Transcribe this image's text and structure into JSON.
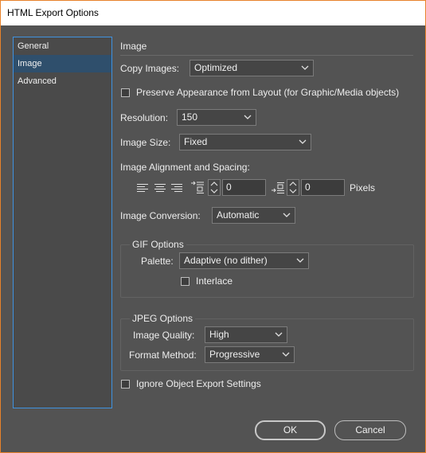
{
  "window": {
    "title": "HTML Export Options",
    "border_color": "#e8822a"
  },
  "sidebar": {
    "items": [
      {
        "label": "General",
        "active": false
      },
      {
        "label": "Image",
        "active": true
      },
      {
        "label": "Advanced",
        "active": false
      }
    ]
  },
  "section": {
    "title": "Image"
  },
  "copy_images": {
    "label": "Copy Images:",
    "value": "Optimized"
  },
  "preserve_appearance": {
    "label": "Preserve Appearance from Layout (for Graphic/Media objects)",
    "checked": false
  },
  "resolution": {
    "label": "Resolution:",
    "value": "150"
  },
  "image_size": {
    "label": "Image Size:",
    "value": "Fixed"
  },
  "alignment": {
    "label": "Image Alignment and Spacing:",
    "icons": [
      "align-left-icon",
      "align-center-icon",
      "align-right-icon",
      "space-before-icon",
      "space-after-icon"
    ],
    "space_before": "0",
    "space_after": "0",
    "unit": "Pixels"
  },
  "image_conversion": {
    "label": "Image Conversion:",
    "value": "Automatic"
  },
  "gif_options": {
    "title": "GIF Options",
    "palette_label": "Palette:",
    "palette_value": "Adaptive (no dither)",
    "interlace_label": "Interlace",
    "interlace_checked": false
  },
  "jpeg_options": {
    "title": "JPEG Options",
    "quality_label": "Image Quality:",
    "quality_value": "High",
    "format_label": "Format Method:",
    "format_value": "Progressive"
  },
  "ignore_export": {
    "label": "Ignore Object Export Settings",
    "checked": false
  },
  "buttons": {
    "ok": "OK",
    "cancel": "Cancel"
  }
}
